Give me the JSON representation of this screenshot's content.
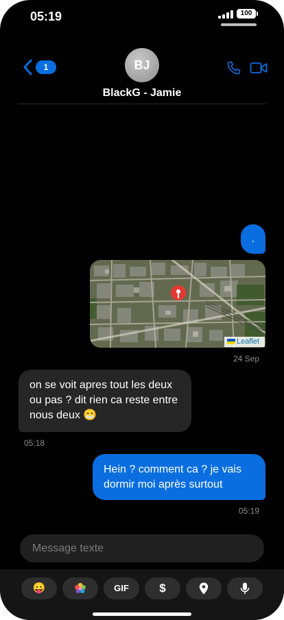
{
  "status_bar": {
    "time": "05:19",
    "battery": "100"
  },
  "header": {
    "back_badge": "1",
    "avatar_initials": "BJ",
    "contact_name": "BlackG - Jamie"
  },
  "messages": [
    {
      "direction": "outgoing",
      "type": "text",
      "text": "."
    },
    {
      "direction": "outgoing",
      "type": "location",
      "attribution": "Leaflet",
      "timestamp": "24 Sep"
    },
    {
      "direction": "incoming",
      "type": "text",
      "text": "on se voit apres tout les deux ou pas ? dit rien ca reste entre nous deux 😁",
      "timestamp": "05:18"
    },
    {
      "direction": "outgoing",
      "type": "text",
      "text": "Hein ? comment ca ? je vais dormir moi après surtout",
      "timestamp": "05:19"
    }
  ],
  "composer": {
    "placeholder": "Message texte",
    "value": ""
  },
  "toolbar": {
    "items": [
      {
        "name": "emoji",
        "icon": "emoji-icon",
        "glyph": "😛"
      },
      {
        "name": "photos",
        "icon": "photos-icon",
        "glyph": ""
      },
      {
        "name": "gif",
        "icon": "gif-icon",
        "label": "GIF"
      },
      {
        "name": "payment",
        "icon": "dollar-icon",
        "label": "$"
      },
      {
        "name": "location",
        "icon": "location-pin-icon"
      },
      {
        "name": "voice",
        "icon": "microphone-icon"
      }
    ]
  },
  "colors": {
    "accent": "#0a6ee0",
    "background": "#000000",
    "incoming_bubble": "#262626",
    "map_pin": "#e53935"
  }
}
